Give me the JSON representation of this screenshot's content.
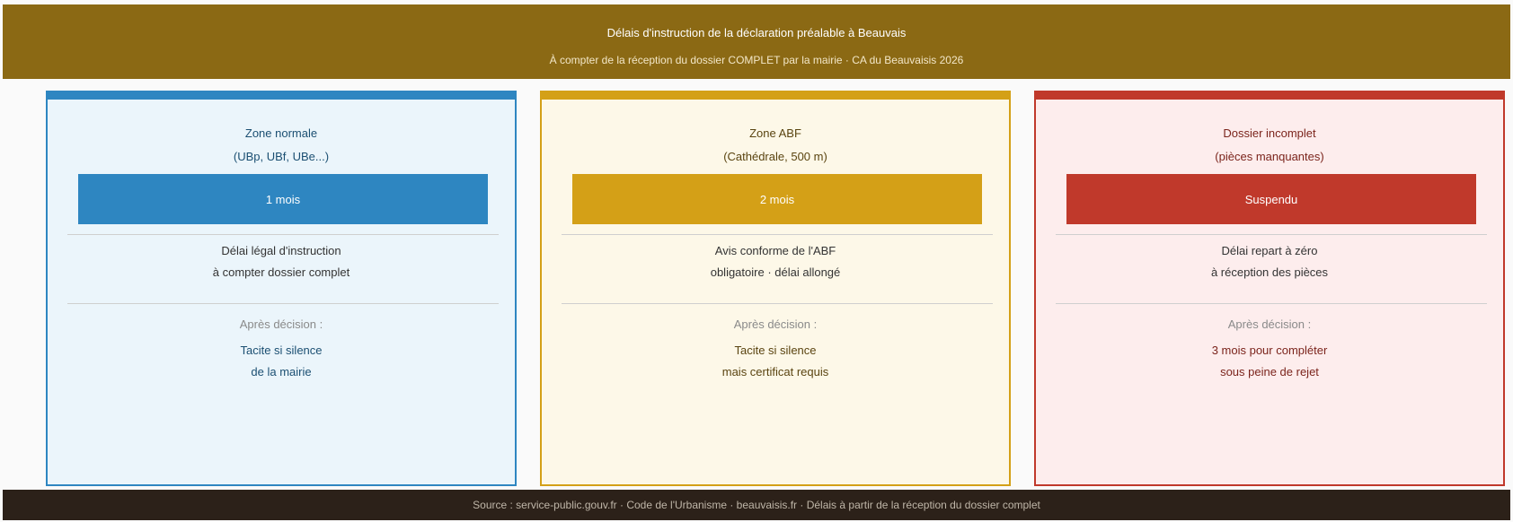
{
  "header": {
    "title": "Délais d'instruction de la déclaration préalable à Beauvais",
    "subtitle": "À compter de la réception du dossier COMPLET par la mairie · CA du Beauvaisis 2026"
  },
  "colors": {
    "header_bg": "#8b6914",
    "blue": "#2e86c1",
    "yellow": "#d4a017",
    "red": "#c0392b",
    "footer_bg": "#2c2119"
  },
  "cards": [
    {
      "title": "Zone normale",
      "subtitle": "(UBp, UBf, UBe...)",
      "badge": "1 mois",
      "desc_line1": "Délai légal d'instruction",
      "desc_line2": "à compter dossier complet",
      "after_label": "Après décision :",
      "result_line1": "Tacite si silence",
      "result_line2": "de la mairie"
    },
    {
      "title": "Zone ABF",
      "subtitle": "(Cathédrale, 500 m)",
      "badge": "2 mois",
      "desc_line1": "Avis conforme de l'ABF",
      "desc_line2": "obligatoire · délai allongé",
      "after_label": "Après décision :",
      "result_line1": "Tacite si silence",
      "result_line2": "mais certificat requis"
    },
    {
      "title": "Dossier incomplet",
      "subtitle": "(pièces manquantes)",
      "badge": "Suspendu",
      "desc_line1": "Délai repart à zéro",
      "desc_line2": "à réception des pièces",
      "after_label": "Après décision :",
      "result_line1": "3 mois pour compléter",
      "result_line2": "sous peine de rejet"
    }
  ],
  "footer": {
    "text": "Source : service-public.gouv.fr · Code de l'Urbanisme · beauvaisis.fr · Délais à partir de la réception du dossier complet"
  }
}
